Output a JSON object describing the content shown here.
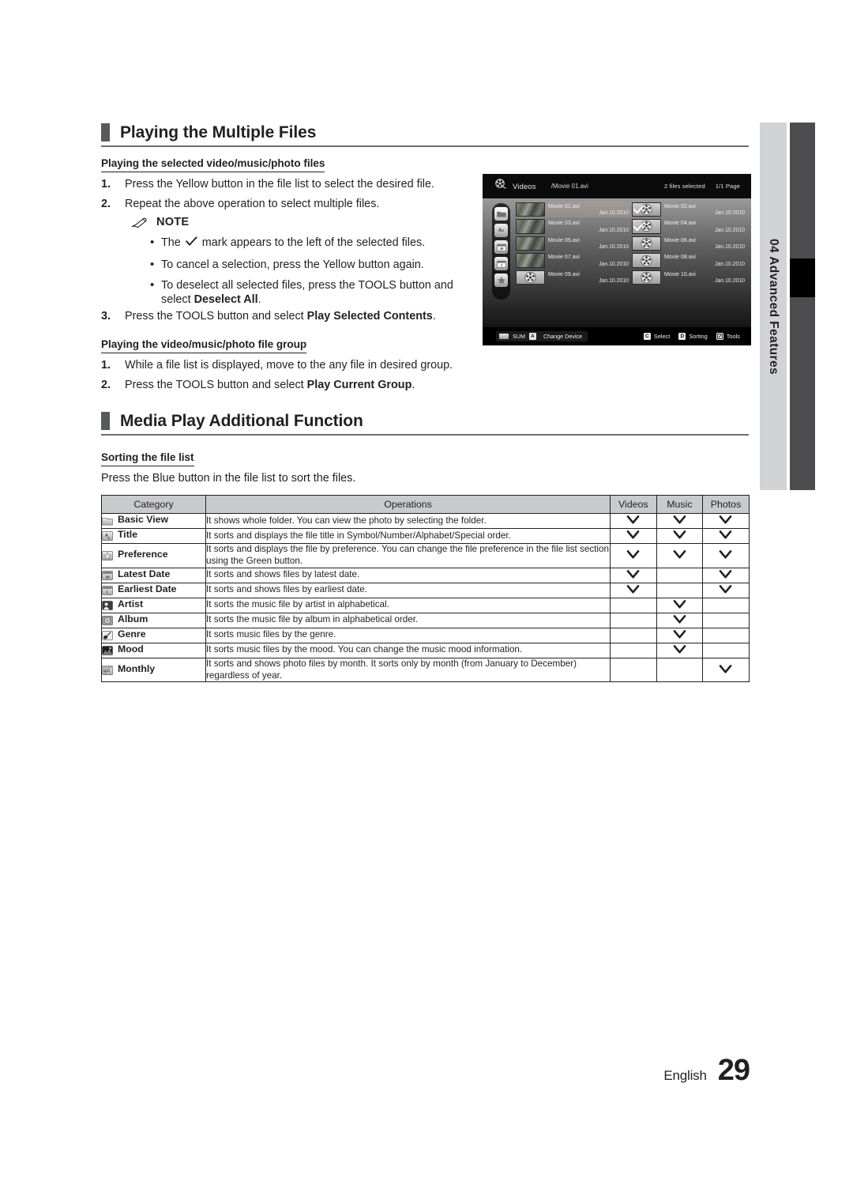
{
  "side_tab": {
    "number": "04",
    "label": "Advanced Features",
    "text": "04  Advanced Features"
  },
  "footer": {
    "language": "English",
    "page_number": "29"
  },
  "section1": {
    "title": "Playing the Multiple Files",
    "sub1": {
      "heading": "Playing the selected video/music/photo files",
      "steps": [
        {
          "num": "1.",
          "text": "Press the Yellow button in the file list to select the desired file."
        },
        {
          "num": "2.",
          "text": "Repeat the above operation to select multiple files."
        }
      ],
      "note_label": "NOTE",
      "note_items": [
        {
          "pre": "The ",
          "post": " mark appears to the left of the selected files.",
          "has_check": true
        },
        {
          "pre": "To cancel a selection, press the Yellow button again.",
          "post": "",
          "has_check": false
        },
        {
          "pre": "To deselect all selected files, press the TOOLS button and select Deselect All.",
          "post": "",
          "has_check": false
        }
      ],
      "step3": {
        "num": "3.",
        "text": "Press the TOOLS button and select Play Selected Contents."
      }
    },
    "sub2": {
      "heading": "Playing the video/music/photo file group",
      "steps": [
        {
          "num": "1.",
          "text": "While a file list is displayed, move to the any file in desired group."
        },
        {
          "num": "2.",
          "text": "Press the TOOLS button and select Play Current Group."
        }
      ]
    }
  },
  "section2": {
    "title": "Media Play Additional Function",
    "sub1": {
      "heading": "Sorting the file list",
      "intro": "Press the Blue button in the file list to sort the files."
    }
  },
  "table": {
    "headers": [
      "Category",
      "Operations",
      "Videos",
      "Music",
      "Photos"
    ],
    "rows": [
      {
        "icon": "folder-icon",
        "category": "Basic View",
        "operation": "It shows whole folder. You can view the photo by selecting the folder.",
        "videos": true,
        "music": true,
        "photos": true
      },
      {
        "icon": "a-z-sort-icon",
        "category": "Title",
        "operation": "It sorts and displays the file title in Symbol/Number/Alphabet/Special order.",
        "videos": true,
        "music": true,
        "photos": true
      },
      {
        "icon": "star-icon",
        "category": "Preference",
        "operation": "It sorts and displays the file by preference. You can change the file preference in the file list section using the Green button.",
        "videos": true,
        "music": true,
        "photos": true
      },
      {
        "icon": "calendar-latest-icon",
        "category": "Latest Date",
        "operation": "It sorts and shows files by latest date.",
        "videos": true,
        "music": false,
        "photos": true
      },
      {
        "icon": "calendar-earliest-icon",
        "category": "Earliest Date",
        "operation": "It sorts and shows files by earliest date.",
        "videos": true,
        "music": false,
        "photos": true
      },
      {
        "icon": "artist-person-icon",
        "category": "Artist",
        "operation": "It sorts the music file by artist in alphabetical.",
        "videos": false,
        "music": true,
        "photos": false
      },
      {
        "icon": "album-disc-icon",
        "category": "Album",
        "operation": "It sorts the music file by album in alphabetical order.",
        "videos": false,
        "music": true,
        "photos": false
      },
      {
        "icon": "genre-guitar-icon",
        "category": "Genre",
        "operation": "It sorts music files by the genre.",
        "videos": false,
        "music": true,
        "photos": false
      },
      {
        "icon": "mood-icon",
        "category": "Mood",
        "operation": "It sorts music files by the mood. You can change the music mood information.",
        "videos": false,
        "music": true,
        "photos": false
      },
      {
        "icon": "calendar-monthly-icon",
        "category": "Monthly",
        "operation": "It sorts and shows photo files by month. It sorts only by month (from January to December) regardless of year.",
        "videos": false,
        "music": false,
        "photos": true
      }
    ]
  },
  "tv_screen": {
    "header": {
      "category": "Videos",
      "path": "/Movie 01.avi",
      "selected_count": "2 files selected",
      "page": "1/1 Page"
    },
    "sidebar_icons": [
      "folder-icon",
      "a-z-sort-icon",
      "calendar-latest-icon",
      "calendar-earliest-icon",
      "star-icon"
    ],
    "files": [
      {
        "name": "Movie 01.avi",
        "date": "Jan.10.2010",
        "checked": false,
        "highlight": true,
        "thumb": "photo"
      },
      {
        "name": "Movie 02.avi",
        "date": "Jan.10.2010",
        "checked": true,
        "highlight": false,
        "thumb": "reel"
      },
      {
        "name": "Movie 03.avi",
        "date": "Jan.10.2010",
        "checked": false,
        "highlight": false,
        "thumb": "photo"
      },
      {
        "name": "Movie 04.avi",
        "date": "Jan.10.2010",
        "checked": true,
        "highlight": false,
        "thumb": "reel"
      },
      {
        "name": "Movie 05.avi",
        "date": "Jan.10.2010",
        "checked": false,
        "highlight": false,
        "thumb": "photo"
      },
      {
        "name": "Movie 06.avi",
        "date": "Jan.10.2010",
        "checked": false,
        "highlight": false,
        "thumb": "reel"
      },
      {
        "name": "Movie 07.avi",
        "date": "Jan.10.2010",
        "checked": false,
        "highlight": false,
        "thumb": "photo"
      },
      {
        "name": "Movie 08.avi",
        "date": "Jan.10.2010",
        "checked": false,
        "highlight": false,
        "thumb": "reel"
      },
      {
        "name": "Movie 09.avi",
        "date": "Jan.10.2010",
        "checked": false,
        "highlight": false,
        "thumb": "reel"
      },
      {
        "name": "Movie 10.avi",
        "date": "Jan.10.2010",
        "checked": false,
        "highlight": false,
        "thumb": "reel"
      }
    ],
    "footer": {
      "device_label": "SUM",
      "change_device_key": "A",
      "change_device_label": "Change Device",
      "select_key": "C",
      "select_label": "Select",
      "sorting_key": "D",
      "sorting_label": "Sorting",
      "tools_label": "Tools"
    }
  }
}
